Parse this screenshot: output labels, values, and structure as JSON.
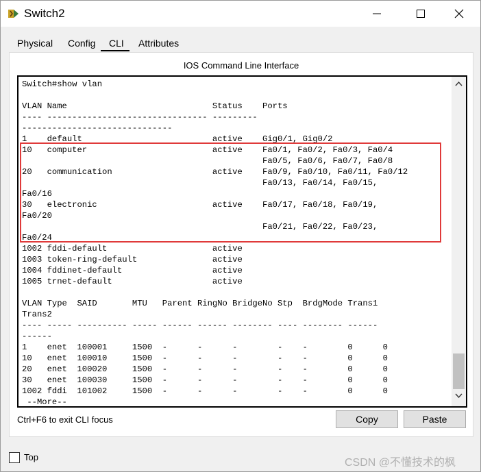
{
  "window": {
    "title": "Switch2"
  },
  "tabs": [
    {
      "label": "Physical"
    },
    {
      "label": "Config"
    },
    {
      "label": "CLI",
      "active": true
    },
    {
      "label": "Attributes"
    }
  ],
  "cli": {
    "panel_title": "IOS Command Line Interface",
    "output": "Switch#show vlan\n\nVLAN Name                             Status    Ports\n---- -------------------------------- ---------\n------------------------------\n1    default                          active    Gig0/1, Gig0/2\n10   computer                         active    Fa0/1, Fa0/2, Fa0/3, Fa0/4\n                                                Fa0/5, Fa0/6, Fa0/7, Fa0/8\n20   communication                    active    Fa0/9, Fa0/10, Fa0/11, Fa0/12\n                                                Fa0/13, Fa0/14, Fa0/15,\nFa0/16\n30   electronic                       active    Fa0/17, Fa0/18, Fa0/19,\nFa0/20\n                                                Fa0/21, Fa0/22, Fa0/23,\nFa0/24\n1002 fddi-default                     active\n1003 token-ring-default               active\n1004 fddinet-default                  active\n1005 trnet-default                    active\n\nVLAN Type  SAID       MTU   Parent RingNo BridgeNo Stp  BrdgMode Trans1\nTrans2\n---- ----- ---------- ----- ------ ------ -------- ---- -------- ------\n------\n1    enet  100001     1500  -      -      -        -    -        0      0\n10   enet  100010     1500  -      -      -        -    -        0      0\n20   enet  100020     1500  -      -      -        -    -        0      0\n30   enet  100030     1500  -      -      -        -    -        0      0\n1002 fddi  101002     1500  -      -      -        -    -        0      0\n --More--",
    "highlight_color": "#e03a3a"
  },
  "footer": {
    "hint": "Ctrl+F6 to exit CLI focus",
    "copy_label": "Copy",
    "paste_label": "Paste"
  },
  "bottom": {
    "top_label": "Top"
  },
  "watermark": "CSDN @不懂技术的枫",
  "icons": {
    "app": "packet-tracer-switch-icon",
    "minimize": "minimize-icon",
    "maximize": "maximize-icon",
    "close": "close-icon"
  }
}
